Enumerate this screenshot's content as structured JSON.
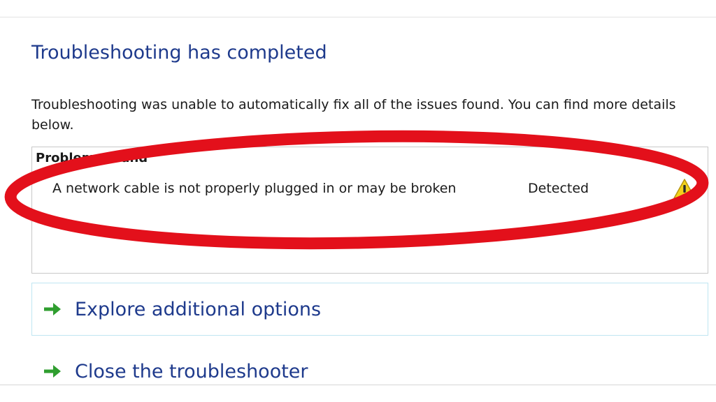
{
  "header": {
    "title": "Troubleshooting has completed"
  },
  "summary": {
    "description": "Troubleshooting was unable to automatically fix all of the issues found. You can find more details below."
  },
  "problems": {
    "heading": "Problems found",
    "items": [
      {
        "text": "A network cable is not properly plugged in or may be broken",
        "status": "Detected",
        "icon": "warning-icon"
      }
    ]
  },
  "options": [
    {
      "label": "Explore additional options",
      "icon": "green-arrow-icon"
    },
    {
      "label": "Close the troubleshooter",
      "icon": "green-arrow-icon"
    }
  ],
  "colors": {
    "title": "#1e3a8c",
    "link": "#1e3a8c",
    "arrow": "#2f9e2f",
    "warning": "#f2d21b",
    "annotation_circle": "#e3101b",
    "option_border": "#bfe6f2"
  }
}
